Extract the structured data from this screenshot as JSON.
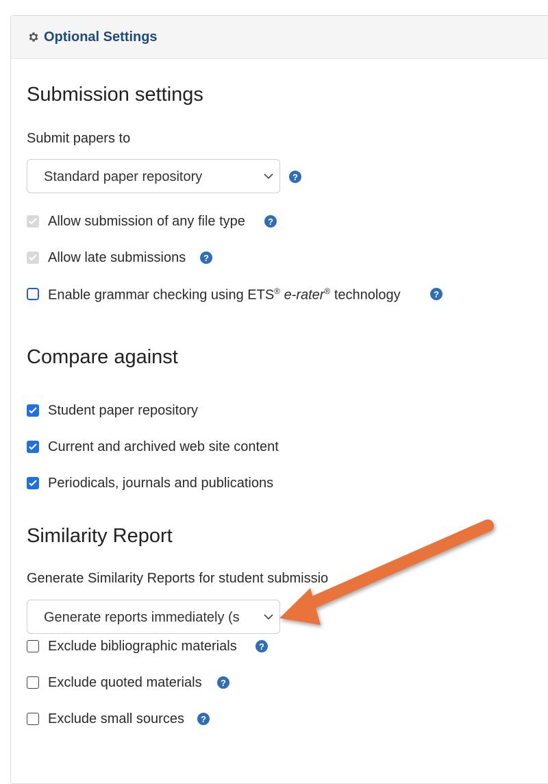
{
  "panel": {
    "title": "Optional Settings",
    "icon": "gear-icon"
  },
  "submission": {
    "heading": "Submission settings",
    "submit_label": "Submit papers to",
    "submit_value": "Standard paper repository",
    "options": [
      {
        "label": "Allow submission of any file type",
        "state": "checked-disabled"
      },
      {
        "label": "Allow late submissions",
        "state": "checked-disabled"
      },
      {
        "label_pre": "Enable grammar checking using ETS",
        "reg": "®",
        "label_em": "e-rater",
        "label_post": " technology",
        "state": "unchecked"
      }
    ]
  },
  "compare": {
    "heading": "Compare against",
    "options": [
      {
        "label": "Student paper repository",
        "state": "checked"
      },
      {
        "label": "Current and archived web site content",
        "state": "checked"
      },
      {
        "label": "Periodicals, journals and publications",
        "state": "checked"
      }
    ]
  },
  "similarity": {
    "heading": "Similarity Report",
    "generate_label": "Generate Similarity Reports for student submissio",
    "generate_value": "Generate reports immediately (s",
    "options": [
      {
        "label": "Exclude bibliographic materials",
        "state": "unchecked"
      },
      {
        "label": "Exclude quoted materials",
        "state": "unchecked"
      },
      {
        "label": "Exclude small sources",
        "state": "unchecked"
      }
    ]
  },
  "colors": {
    "link": "#1f4a7c",
    "checkbox": "#1f70e0",
    "help": "#2f6db5",
    "arrow": "#e8733a"
  },
  "icons": {
    "help": "question-circle-icon",
    "chevron": "chevron-down-icon",
    "check": "checkmark-icon"
  }
}
